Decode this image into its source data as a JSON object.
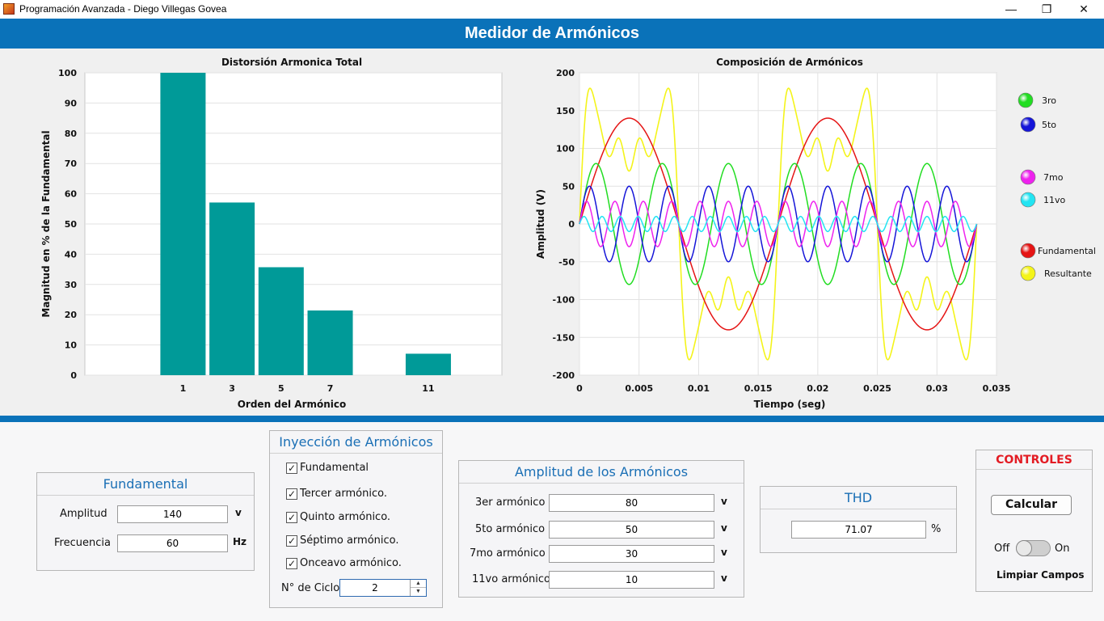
{
  "window": {
    "title": "Programación Avanzada - Diego Villegas Govea",
    "minimize": "—",
    "restore": "❐",
    "close": "✕"
  },
  "header": {
    "title": "Medidor de Armónicos"
  },
  "colors": {
    "accent": "#0a72b9",
    "bar": "#009a98",
    "panel_title": "#1a6fb5",
    "controls_title": "#e31b23"
  },
  "left_chart": {
    "title": "Distorsión Armonica Total",
    "xlabel": "Orden del Armónico",
    "ylabel": "Magnitud en % de la Fundamental",
    "y_ticks": [
      "0",
      "10",
      "20",
      "30",
      "40",
      "50",
      "60",
      "70",
      "80",
      "90",
      "100"
    ],
    "x_ticks": [
      "1",
      "3",
      "5",
      "7",
      "11"
    ]
  },
  "right_chart": {
    "title": "Composición de Armónicos",
    "xlabel": "Tiempo (seg)",
    "ylabel": "Amplitud (V)",
    "y_ticks": [
      "-200",
      "-150",
      "-100",
      "-50",
      "0",
      "50",
      "100",
      "150",
      "200"
    ],
    "x_ticks": [
      "0",
      "0.005",
      "0.01",
      "0.015",
      "0.02",
      "0.025",
      "0.03",
      "0.035"
    ]
  },
  "legend": {
    "items": [
      {
        "label": "3ro",
        "color": "#22dd22"
      },
      {
        "label": "5to",
        "color": "#1515d8"
      },
      {
        "label": "7mo",
        "color": "#ee22ee"
      },
      {
        "label": "11vo",
        "color": "#22e4f2"
      },
      {
        "label": "Fundamental",
        "color": "#e51414"
      },
      {
        "label": "Resultante",
        "color": "#f4f41a"
      }
    ]
  },
  "chart_data": [
    {
      "type": "bar",
      "title": "Distorsión Armonica Total",
      "xlabel": "Orden del Armónico",
      "ylabel": "Magnitud en % de la Fundamental",
      "categories": [
        "1",
        "3",
        "5",
        "7",
        "11"
      ],
      "x": [
        1,
        3,
        5,
        7,
        11
      ],
      "values": [
        100,
        57.1,
        35.7,
        21.4,
        7.1
      ],
      "xlim": [
        -3,
        14
      ],
      "ylim": [
        0,
        100
      ],
      "grid": true
    },
    {
      "type": "line",
      "title": "Composición de Armónicos",
      "xlabel": "Tiempo (seg)",
      "ylabel": "Amplitud (V)",
      "xlim": [
        0,
        0.035
      ],
      "ylim": [
        -200,
        200
      ],
      "grid": true,
      "legend": "right",
      "frequency_hz": 60,
      "cycles": 2,
      "series": [
        {
          "name": "Fundamental",
          "harmonic": 1,
          "amplitude": 140,
          "color": "#e51414"
        },
        {
          "name": "3ro",
          "harmonic": 3,
          "amplitude": 80,
          "color": "#22dd22"
        },
        {
          "name": "5to",
          "harmonic": 5,
          "amplitude": 50,
          "color": "#1515d8"
        },
        {
          "name": "7mo",
          "harmonic": 7,
          "amplitude": 30,
          "color": "#ee22ee"
        },
        {
          "name": "11vo",
          "harmonic": 11,
          "amplitude": 10,
          "color": "#22e4f2"
        },
        {
          "name": "Resultante",
          "harmonic": 0,
          "amplitude": 0,
          "color": "#f4f41a"
        }
      ]
    }
  ],
  "fundamental": {
    "title": "Fundamental",
    "amplitude_label": "Amplitud",
    "amplitude_value": "140",
    "amplitude_unit": "v",
    "frequency_label": "Frecuencia",
    "frequency_value": "60",
    "frequency_unit": "Hz"
  },
  "injection": {
    "title": "Inyección de Armónicos",
    "checks": [
      {
        "label": "Fundamental",
        "checked": "✓"
      },
      {
        "label": "Tercer armónico.",
        "checked": "✓"
      },
      {
        "label": "Quinto armónico.",
        "checked": "✓"
      },
      {
        "label": "Séptimo armónico.",
        "checked": "✓"
      },
      {
        "label": "Onceavo armónico.",
        "checked": "✓"
      }
    ],
    "cycles_label": "N° de Ciclos",
    "cycles_value": "2",
    "spin_up": "▲",
    "spin_down": "▼"
  },
  "amplitudes": {
    "title": "Amplitud de los Armónicos",
    "rows": [
      {
        "label": "3er armónico",
        "value": "80",
        "unit": "v"
      },
      {
        "label": "5to armónico",
        "value": "50",
        "unit": "v"
      },
      {
        "label": "7mo armónico",
        "value": "30",
        "unit": "v"
      },
      {
        "label": "11vo armónico",
        "value": "10",
        "unit": "v"
      }
    ]
  },
  "thd": {
    "title": "THD",
    "value": "71.07",
    "unit": "%"
  },
  "controls": {
    "title": "CONTROLES",
    "calc_label": "Calcular",
    "switch_off": "Off",
    "switch_on": "On",
    "clear_label": "Limpiar Campos"
  }
}
